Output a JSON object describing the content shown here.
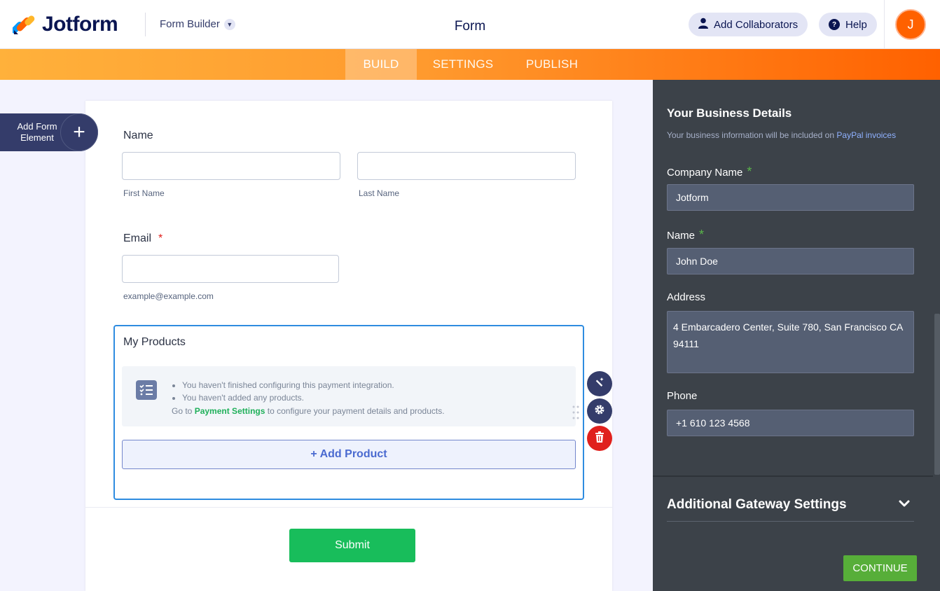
{
  "header": {
    "logo_text": "Jotform",
    "builder_label": "Form Builder",
    "form_title": "Form",
    "collaborators_label": "Add Collaborators",
    "help_label": "Help",
    "avatar_initial": "J"
  },
  "nav": {
    "tabs": [
      {
        "label": "BUILD",
        "active": true
      },
      {
        "label": "SETTINGS",
        "active": false
      },
      {
        "label": "PUBLISH",
        "active": false
      }
    ]
  },
  "add_element": {
    "line1": "Add Form",
    "line2": "Element"
  },
  "form": {
    "name_label": "Name",
    "first_name_sub": "First Name",
    "last_name_sub": "Last Name",
    "email_label": "Email",
    "email_required": "*",
    "email_sub": "example@example.com",
    "products": {
      "title": "My Products",
      "notice_items": [
        "You haven't finished configuring this payment integration.",
        "You haven't added any products."
      ],
      "notice_go_prefix": "Go to",
      "notice_link": "Payment Settings",
      "notice_go_suffix": "to configure your payment details and products.",
      "add_product_label": "+ Add Product"
    },
    "submit_label": "Submit"
  },
  "panel": {
    "heading": "Your Business Details",
    "subtitle_prefix": "Your business information will be included on",
    "subtitle_link": "PayPal invoices",
    "company_label": "Company Name",
    "company_value": "Jotform",
    "name_label": "Name",
    "name_value": "John Doe",
    "address_label": "Address",
    "address_value": "4 Embarcadero Center, Suite 780, San Francisco CA 94111",
    "phone_label": "Phone",
    "phone_value": "+1 610 123 4568",
    "required_mark": "*",
    "gateway_heading": "Additional Gateway Settings",
    "continue_label": "CONTINUE"
  },
  "colors": {
    "brand_orange": "#ff6100",
    "navy": "#0a1551",
    "panel_bg": "#3c4249",
    "submit_green": "#18bd5b",
    "continue_green": "#57ae39",
    "selection_blue": "#2e8ce0"
  },
  "icons": [
    "jotform-logo-icon",
    "chevron-down-icon",
    "user-icon",
    "question-icon",
    "plus-icon",
    "list-check-icon",
    "magic-wand-icon",
    "gear-icon",
    "trash-icon",
    "drag-handle-icon"
  ]
}
